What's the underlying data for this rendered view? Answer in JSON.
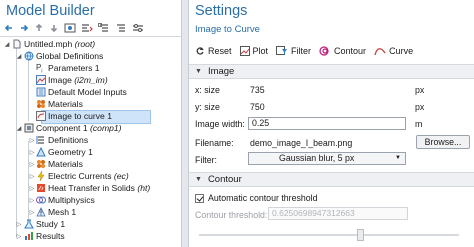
{
  "left": {
    "title": "Model Builder",
    "tree": [
      {
        "label": "Untitled.mph",
        "tag": "(root)"
      },
      {
        "label": "Global Definitions",
        "tag": ""
      },
      {
        "label": "Parameters 1",
        "tag": ""
      },
      {
        "label": "Image",
        "tag": "(i2m_im)"
      },
      {
        "label": "Default Model Inputs",
        "tag": ""
      },
      {
        "label": "Materials",
        "tag": ""
      },
      {
        "label": "Image to curve 1",
        "tag": ""
      },
      {
        "label": "Component 1",
        "tag": "(comp1)"
      },
      {
        "label": "Definitions",
        "tag": ""
      },
      {
        "label": "Geometry 1",
        "tag": ""
      },
      {
        "label": "Materials",
        "tag": ""
      },
      {
        "label": "Electric Currents",
        "tag": "(ec)"
      },
      {
        "label": "Heat Transfer in Solids",
        "tag": "(ht)"
      },
      {
        "label": "Multiphysics",
        "tag": ""
      },
      {
        "label": "Mesh 1",
        "tag": ""
      },
      {
        "label": "Study 1",
        "tag": ""
      },
      {
        "label": "Results",
        "tag": ""
      }
    ]
  },
  "right": {
    "title": "Settings",
    "subtitle": "Image to Curve",
    "toolbar": {
      "reset": "Reset",
      "plot": "Plot",
      "filter": "Filter",
      "contour": "Contour",
      "curve": "Curve"
    },
    "image_section": {
      "title": "Image",
      "x_size_label": "x: size",
      "x_size_value": "735",
      "x_size_unit": "px",
      "y_size_label": "y: size",
      "y_size_value": "750",
      "y_size_unit": "px",
      "width_label": "Image width:",
      "width_value": "0.25",
      "width_unit": "m",
      "filename_label": "Filename:",
      "filename_value": "demo_image_I_beam.png",
      "browse_label": "Browse...",
      "filter_label": "Filter:",
      "filter_value": "Gaussian blur, 5 px"
    },
    "contour_section": {
      "title": "Contour",
      "auto_threshold_label": "Automatic contour threshold",
      "auto_threshold_checked": true,
      "threshold_label": "Contour threshold:",
      "threshold_value": "0.6250698947312663"
    }
  }
}
